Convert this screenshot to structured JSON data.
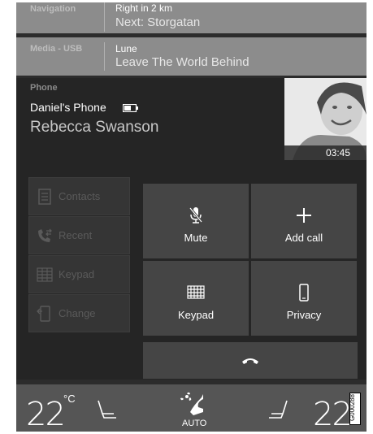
{
  "navigation": {
    "label": "Navigation",
    "instruction": "Right in 2 km",
    "next": "Next: Storgatan"
  },
  "media": {
    "label": "Media - USB",
    "artist": "Lune",
    "track": "Leave The World Behind"
  },
  "phone": {
    "label": "Phone",
    "device": "Daniel's Phone",
    "caller": "Rebecca Swanson",
    "duration": "03:45"
  },
  "menu": {
    "items": [
      {
        "label": "Contacts",
        "icon": "contacts-icon"
      },
      {
        "label": "Recent",
        "icon": "recent-calls-icon"
      },
      {
        "label": "Keypad",
        "icon": "keypad-icon"
      },
      {
        "label": "Change",
        "icon": "change-phone-icon"
      }
    ]
  },
  "call_controls": {
    "mute": "Mute",
    "add_call": "Add call",
    "keypad": "Keypad",
    "privacy": "Privacy"
  },
  "climate": {
    "left_temp": "22",
    "unit": "°C",
    "right_temp": "22",
    "mode": "AUTO"
  },
  "image_code": "G000288",
  "colors": {
    "screen_bg": "#2c2c2c",
    "tile_bg": "#8c8c8c",
    "button_bg": "#454545",
    "climate_bg": "#555555"
  }
}
